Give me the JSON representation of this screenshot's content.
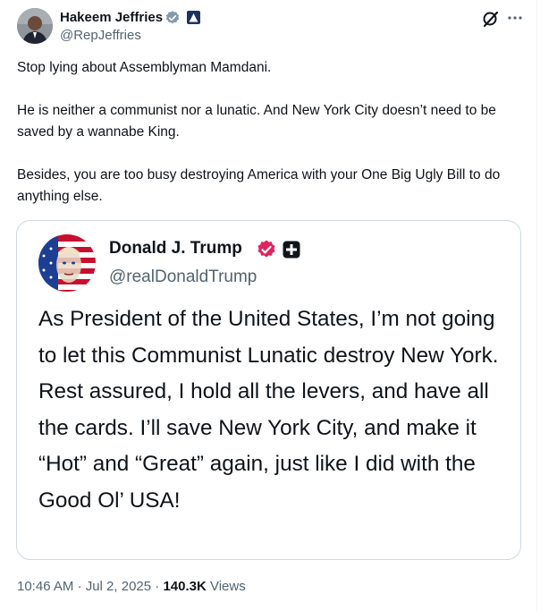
{
  "author": {
    "name": "Hakeem Jeffries",
    "handle": "@RepJeffries"
  },
  "tweet": {
    "paragraphs": [
      "Stop lying about Assemblyman Mamdani.",
      "He is neither a communist nor a lunatic. And New York City doesn’t need to be saved by a wannabe King.",
      "Besides, you are too busy destroying America with your One Big Ugly Bill to do anything else."
    ]
  },
  "quote": {
    "name": "Donald J. Trump",
    "handle": "@realDonaldTrump",
    "text": "As President of the United States, I’m not going to let this Communist Lunatic destroy New York. Rest assured, I hold all the levers, and have all the cards. I’ll save New York City, and make it “Hot” and “Great” again, just like I did with the Good Ol’ USA!"
  },
  "meta": {
    "timestamp": "10:46 AM · Jul 2, 2025",
    "separator": " · ",
    "views_count": "140.3K",
    "views_label": " Views"
  },
  "icons": {
    "verified_gray": "verified-gray-icon",
    "government": "government-badge-icon",
    "grok": "grok-icon",
    "more": "more-icon",
    "verified_pink": "verified-pink-icon",
    "plus": "plus-badge-icon"
  },
  "colors": {
    "text": "#0f1419",
    "secondary": "#536471",
    "border": "#cfd9de",
    "verified_gray": "#829aab",
    "verified_pink": "#e0245e"
  }
}
